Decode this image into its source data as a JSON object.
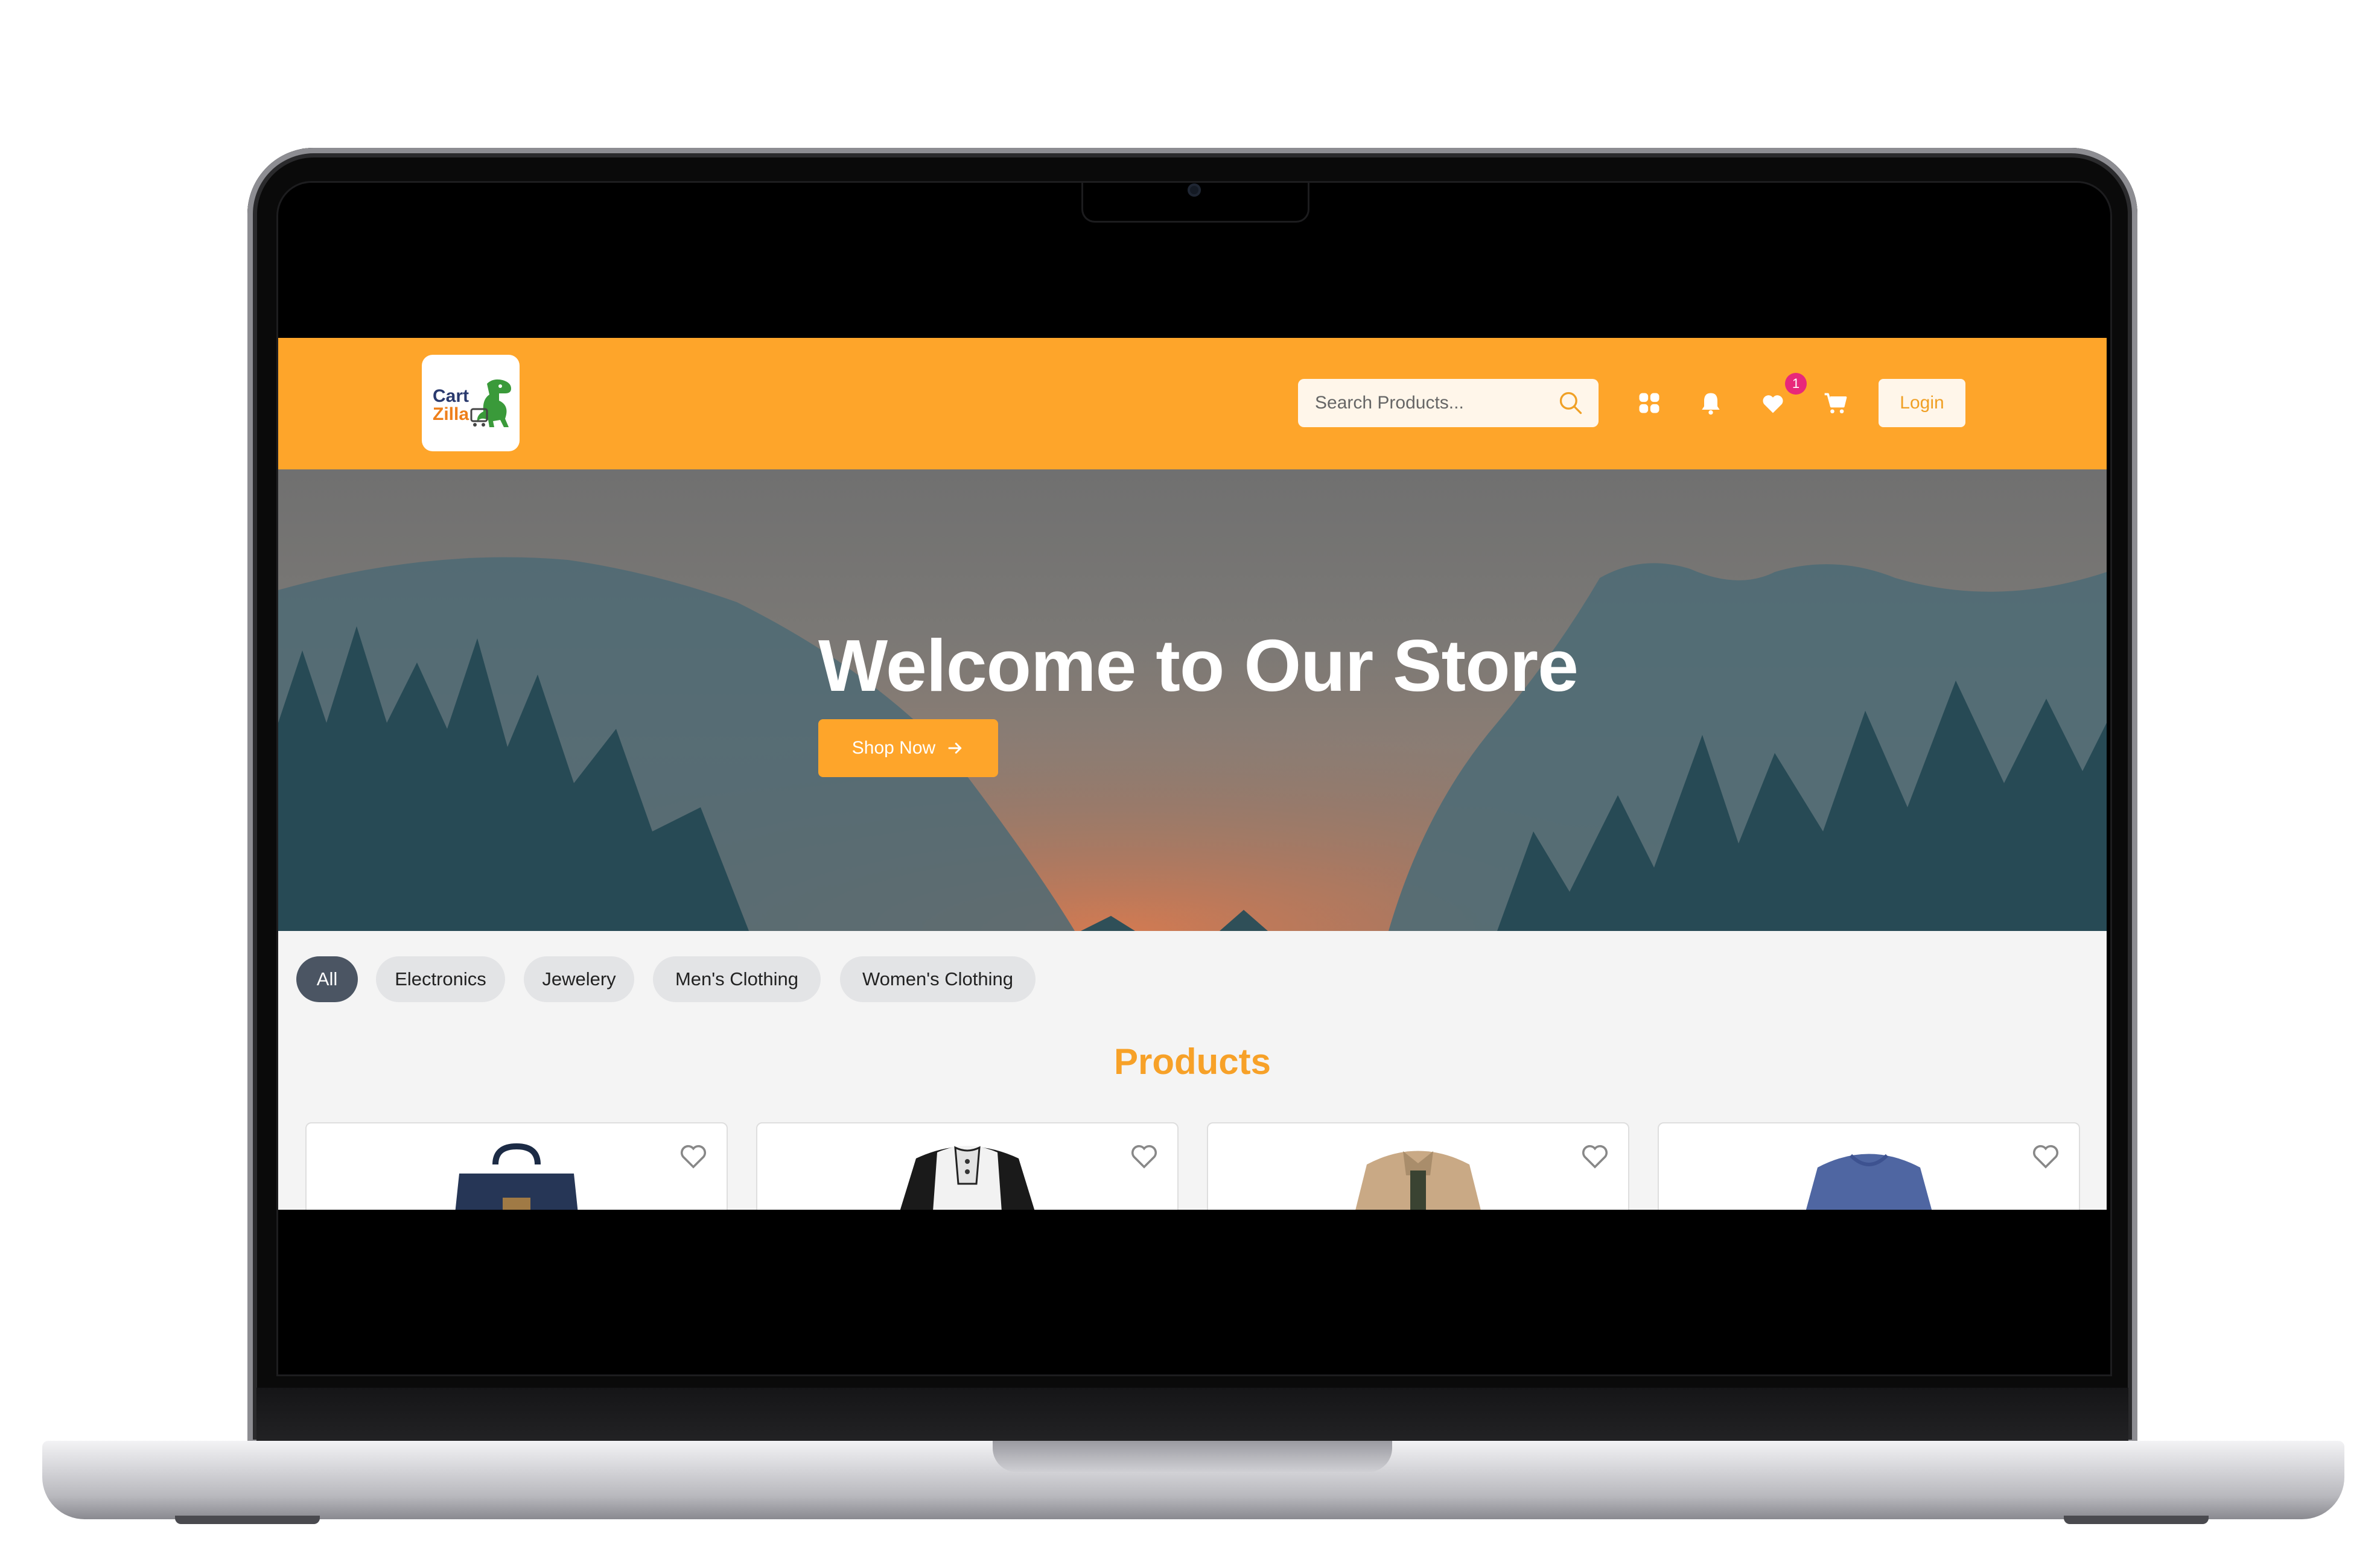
{
  "brand": {
    "logo_line1": "Cart",
    "logo_line2": "Zilla"
  },
  "header": {
    "search_placeholder": "Search Products...",
    "wishlist_count": "1",
    "login_label": "Login"
  },
  "hero": {
    "title": "Welcome to Our Store",
    "cta_label": "Shop Now"
  },
  "filters": [
    "All",
    "Electronics",
    "Jewelery",
    "Men's Clothing",
    "Women's Clothing"
  ],
  "active_filter": "All",
  "products": {
    "title": "Products",
    "items": [
      {
        "kind": "backpack"
      },
      {
        "kind": "henley-shirt"
      },
      {
        "kind": "jacket"
      },
      {
        "kind": "t-shirt"
      }
    ]
  },
  "colors": {
    "brand_orange": "#fea52a",
    "active_chip": "#4b5563",
    "badge_pink": "#e8287a",
    "search_bg": "#fff6ea"
  },
  "icons": [
    "search-icon",
    "grid-icon",
    "bell-icon",
    "heart-icon",
    "cart-icon",
    "arrow-right-icon",
    "heart-outline-icon"
  ]
}
